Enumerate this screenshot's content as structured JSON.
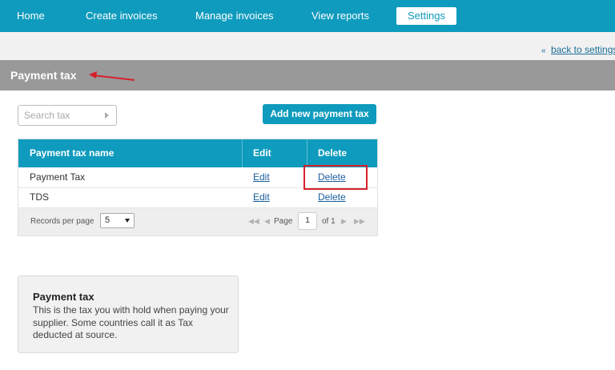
{
  "nav": {
    "items": [
      {
        "label": "Home"
      },
      {
        "label": "Create invoices"
      },
      {
        "label": "Manage invoices"
      },
      {
        "label": "View reports"
      },
      {
        "label": "Settings",
        "active": true
      }
    ]
  },
  "back_link": {
    "arrow": "«",
    "label": "back to settings"
  },
  "page": {
    "title": "Payment tax"
  },
  "search": {
    "placeholder": "Search tax"
  },
  "add_button": {
    "label": "Add new payment tax"
  },
  "table": {
    "columns": [
      "Payment tax name",
      "Edit",
      "Delete"
    ],
    "rows": [
      {
        "name": "Payment Tax",
        "edit": "Edit",
        "delete": "Delete"
      },
      {
        "name": "TDS",
        "edit": "Edit",
        "delete": "Delete"
      }
    ],
    "footer": {
      "records_per_page_label": "Records per page",
      "records_per_page_value": "5",
      "page_label": "Page",
      "page_value": "1",
      "of_label": "of 1"
    }
  },
  "info": {
    "title": "Payment tax",
    "text": "This is the tax you with hold when paying your supplier. Some countries call it as Tax deducted at source."
  },
  "colors": {
    "accent": "#0f9bbd",
    "header_bar": "#999999",
    "highlight": "#d6202a",
    "link": "#1a5e9c"
  },
  "icons": [
    "first-page-icon",
    "prev-page-icon",
    "next-page-icon",
    "last-page-icon",
    "dropdown-arrow-icon",
    "back-arrow-icon"
  ]
}
